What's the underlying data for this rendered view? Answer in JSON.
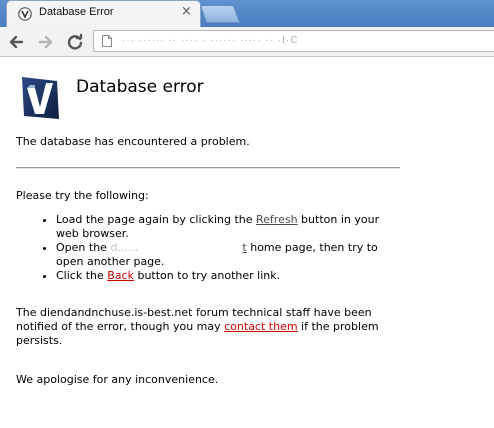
{
  "browser": {
    "tab_title": "Database Error",
    "tab_close": "×",
    "url": "··· ······ ·· ···· · ······ ····· ·· ·I·C"
  },
  "page": {
    "heading": "Database error",
    "intro": "The database has encountered a problem.",
    "try_heading": "Please try the following:",
    "tips": {
      "t1_before": "Load the page again by clicking the ",
      "t1_link": "Refresh",
      "t1_after": " button in your web browser.",
      "t2_before": "Open the ",
      "t2_blur": "d......",
      "t2_link_end": "t",
      "t2_after": " home page, then try to open another page.",
      "t3_before": "Click the ",
      "t3_link": "Back",
      "t3_after": " button to try another link."
    },
    "notice_before": "The diendandnchuse.is-best.net forum technical staff have been notified of the error, though you may ",
    "notice_link": "contact them",
    "notice_after": " if the problem persists.",
    "apology": "We apologise for any inconvenience."
  }
}
